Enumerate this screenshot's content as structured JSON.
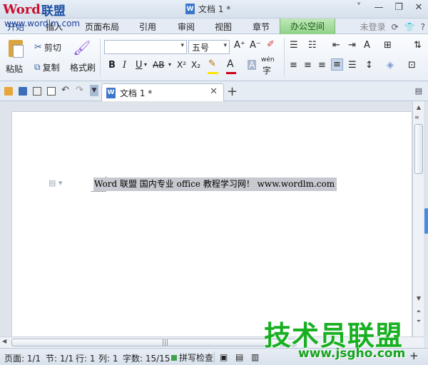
{
  "app": {
    "logo_main": "Word",
    "logo_cn": "联盟",
    "logo_url": "www.wordlm.com",
    "doc_icon_letter": "W",
    "document_title": "文档 1 *"
  },
  "window_controls": [
    "˅",
    "—",
    "❐",
    "✕"
  ],
  "menu_tabs": [
    "开始",
    "插入",
    "页面布局",
    "引用",
    "审阅",
    "视图",
    "章节"
  ],
  "menu_office_space": "办公空间",
  "menu_right": {
    "login": "未登录",
    "help": "?"
  },
  "ribbon": {
    "paste": "粘贴",
    "cut": "剪切",
    "copy": "复制",
    "format_painter": "格式刷",
    "font_name_value": "",
    "font_size_value": "五号",
    "bold": "B",
    "italic": "I",
    "underline": "U",
    "strike": "AB",
    "superscript": "X²",
    "subscript": "X₂",
    "font_color_glyph": "A",
    "char_shading_glyph": "A",
    "phonetic_glyph": "wén",
    "grow_font": "A⁺",
    "shrink_font": "A⁻",
    "text_effect": "A"
  },
  "colors": {
    "highlight": "#ffe600",
    "font_color": "#d0021b",
    "shading": "#7a9acc",
    "office_tab": "#8fd187",
    "watermark": "#18b022"
  },
  "document_tab": {
    "label": "文档 1 *"
  },
  "document": {
    "selected_text": "Word 联盟  国内专业 office 教程学习网！ www.wordlm.com"
  },
  "statusbar": {
    "page": "页面: 1/1",
    "section": "节: 1/1",
    "line": "行: 1",
    "column": "列: 1",
    "word_count": "字数: 15/15",
    "spell_check": "拼写检查"
  },
  "watermark": {
    "title": "技术员联盟",
    "url": "www.jsgho.com"
  }
}
